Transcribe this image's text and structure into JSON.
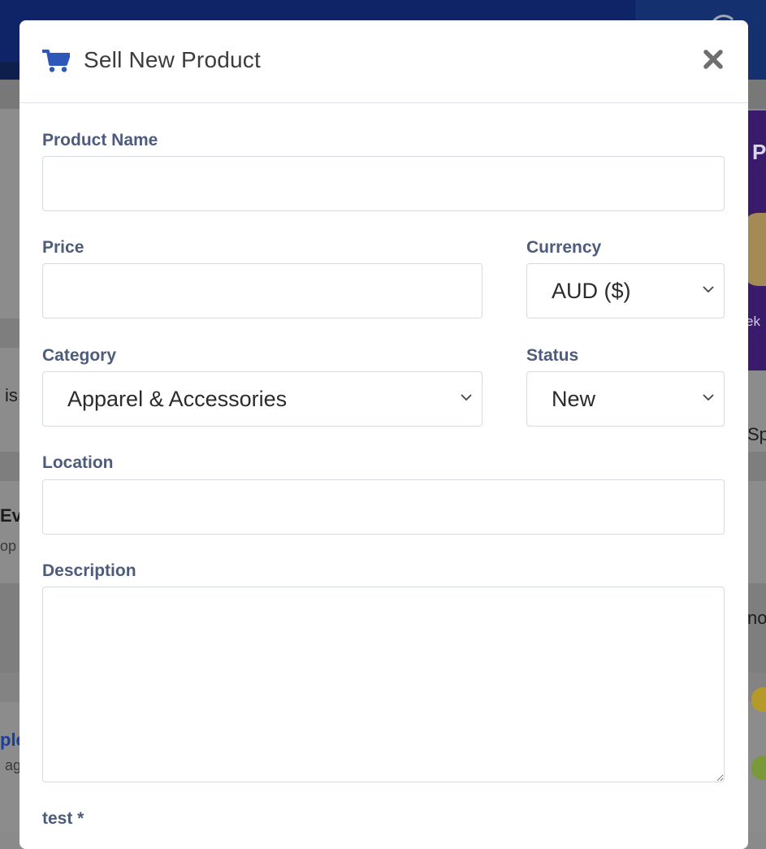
{
  "modal": {
    "title": "Sell New Product",
    "icon": "shopping-cart-icon",
    "close_icon": "close-icon",
    "accent": "#2d57b8",
    "label_color": "#4d5b7c"
  },
  "form": {
    "product_name": {
      "label": "Product Name",
      "value": ""
    },
    "price": {
      "label": "Price",
      "value": ""
    },
    "currency": {
      "label": "Currency",
      "selected": "AUD ($)"
    },
    "category": {
      "label": "Category",
      "selected": "Apparel & Accessories"
    },
    "status": {
      "label": "Status",
      "selected": "New"
    },
    "location": {
      "label": "Location",
      "value": ""
    },
    "description": {
      "label": "Description",
      "value": ""
    },
    "test": {
      "label": "test *"
    }
  },
  "background": {
    "frag_is": "is",
    "frag_ev": "Ev",
    "frag_op": "op",
    "frag_ple": "ple",
    "frag_ag": "ag",
    "frag_sp": "Sp",
    "frag_no": "no",
    "frag_ek": "ek",
    "frag_p": "P"
  }
}
